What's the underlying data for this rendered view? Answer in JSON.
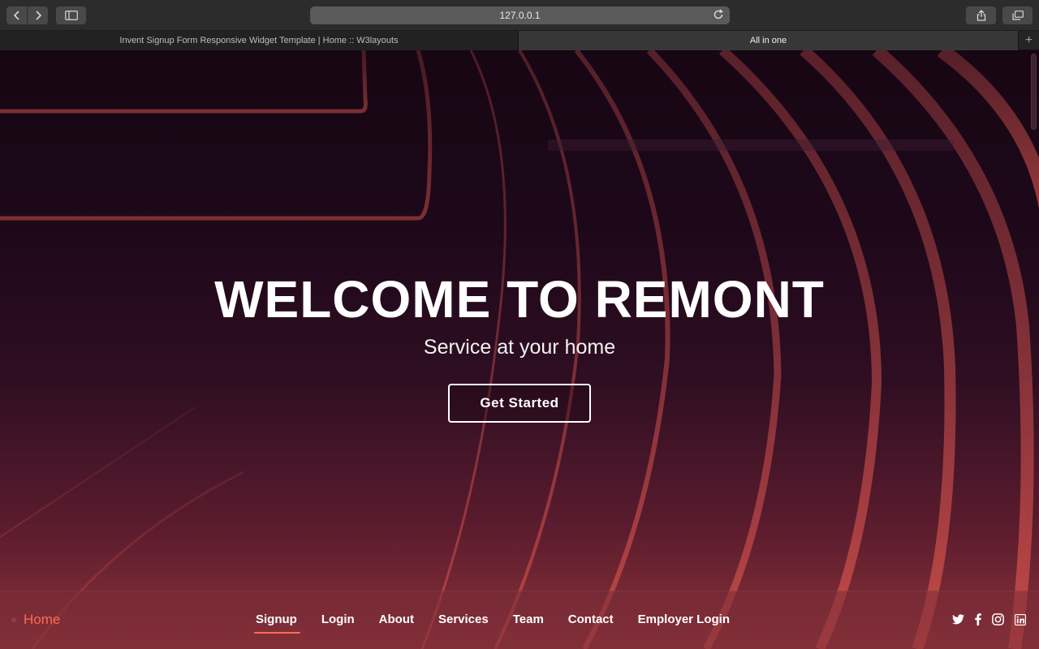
{
  "browser": {
    "url": "127.0.0.1",
    "tabs": [
      {
        "label": "Invent Signup Form Responsive Widget Template | Home :: W3layouts"
      },
      {
        "label": "All in one"
      }
    ]
  },
  "hero": {
    "title": "WELCOME TO REMONT",
    "subtitle": "Service at your home",
    "cta_label": "Get Started"
  },
  "nav": {
    "brand": "Home",
    "items": [
      {
        "label": "Signup"
      },
      {
        "label": "Login"
      },
      {
        "label": "About"
      },
      {
        "label": "Services"
      },
      {
        "label": "Team"
      },
      {
        "label": "Contact"
      },
      {
        "label": "Employer Login"
      }
    ],
    "social_icons": [
      "twitter-icon",
      "facebook-icon",
      "instagram-icon",
      "linkedin-icon"
    ]
  },
  "colors": {
    "accent": "#ff6b4f",
    "text": "#ffffff",
    "background_top": "#170614",
    "background_bottom": "#8e3437"
  }
}
